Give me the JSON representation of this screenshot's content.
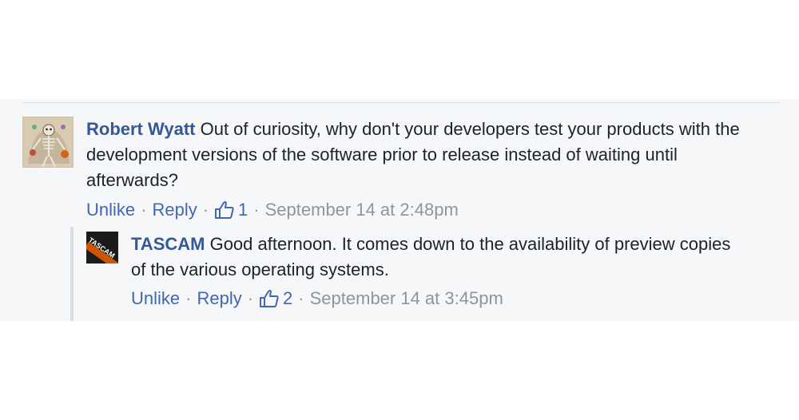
{
  "comments": [
    {
      "author": "Robert Wyatt",
      "text": " Out of curiosity, why don't your developers test your products with the development versions of the software prior to release instead of waiting until afterwards?",
      "unlike_label": "Unlike",
      "reply_label": "Reply",
      "like_count": "1",
      "timestamp": "September 14 at 2:48pm"
    },
    {
      "author": "TASCAM",
      "avatar_text": "TASCAM",
      "text": " Good afternoon. It comes down to the availability of preview copies of the various operating systems.",
      "unlike_label": "Unlike",
      "reply_label": "Reply",
      "like_count": "2",
      "timestamp": "September 14 at 3:45pm"
    }
  ],
  "separator": "·",
  "colors": {
    "author": "#365899",
    "link": "#4267b2",
    "meta": "#90949c",
    "thread_bg": "#f6f7f9"
  },
  "icons": {
    "like": "thumbs-up-icon"
  }
}
